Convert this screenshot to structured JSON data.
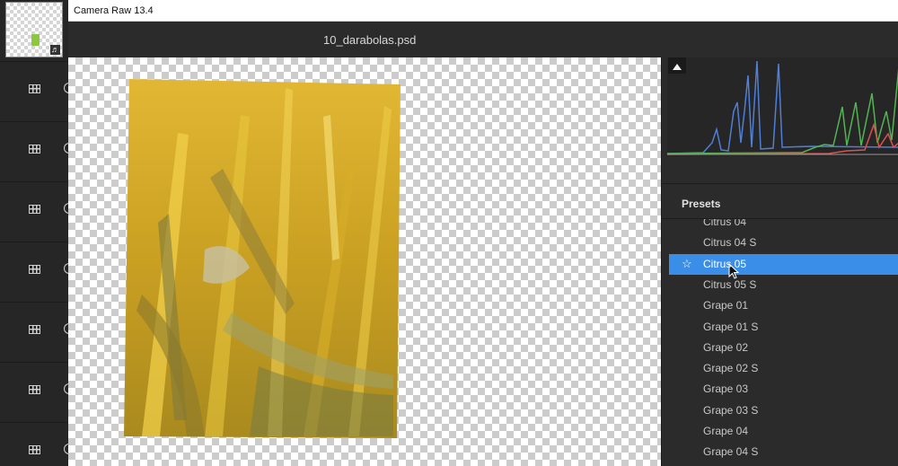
{
  "window": {
    "title": "Camera Raw 13.4"
  },
  "document": {
    "file_name": "10_darabolas.psd"
  },
  "filmstrip": {
    "thumbnail_badge": "♬",
    "rows": 7
  },
  "presets": {
    "header": "Presets",
    "items": [
      {
        "label": "Citrus 04",
        "selected": false
      },
      {
        "label": "Citrus 04 S",
        "selected": false
      },
      {
        "label": "Citrus 05",
        "selected": true
      },
      {
        "label": "Citrus 05 S",
        "selected": false
      },
      {
        "label": "Grape 01",
        "selected": false
      },
      {
        "label": "Grape 01 S",
        "selected": false
      },
      {
        "label": "Grape 02",
        "selected": false
      },
      {
        "label": "Grape 02 S",
        "selected": false
      },
      {
        "label": "Grape 03",
        "selected": false
      },
      {
        "label": "Grape 03 S",
        "selected": false
      },
      {
        "label": "Grape 04",
        "selected": false
      },
      {
        "label": "Grape 04 S",
        "selected": false
      }
    ]
  },
  "colors": {
    "selection": "#3b8ee8",
    "panel": "#2b2b2b",
    "histogram_blue": "#4f7fd6",
    "histogram_green": "#52b552",
    "histogram_red": "#d9534f"
  }
}
